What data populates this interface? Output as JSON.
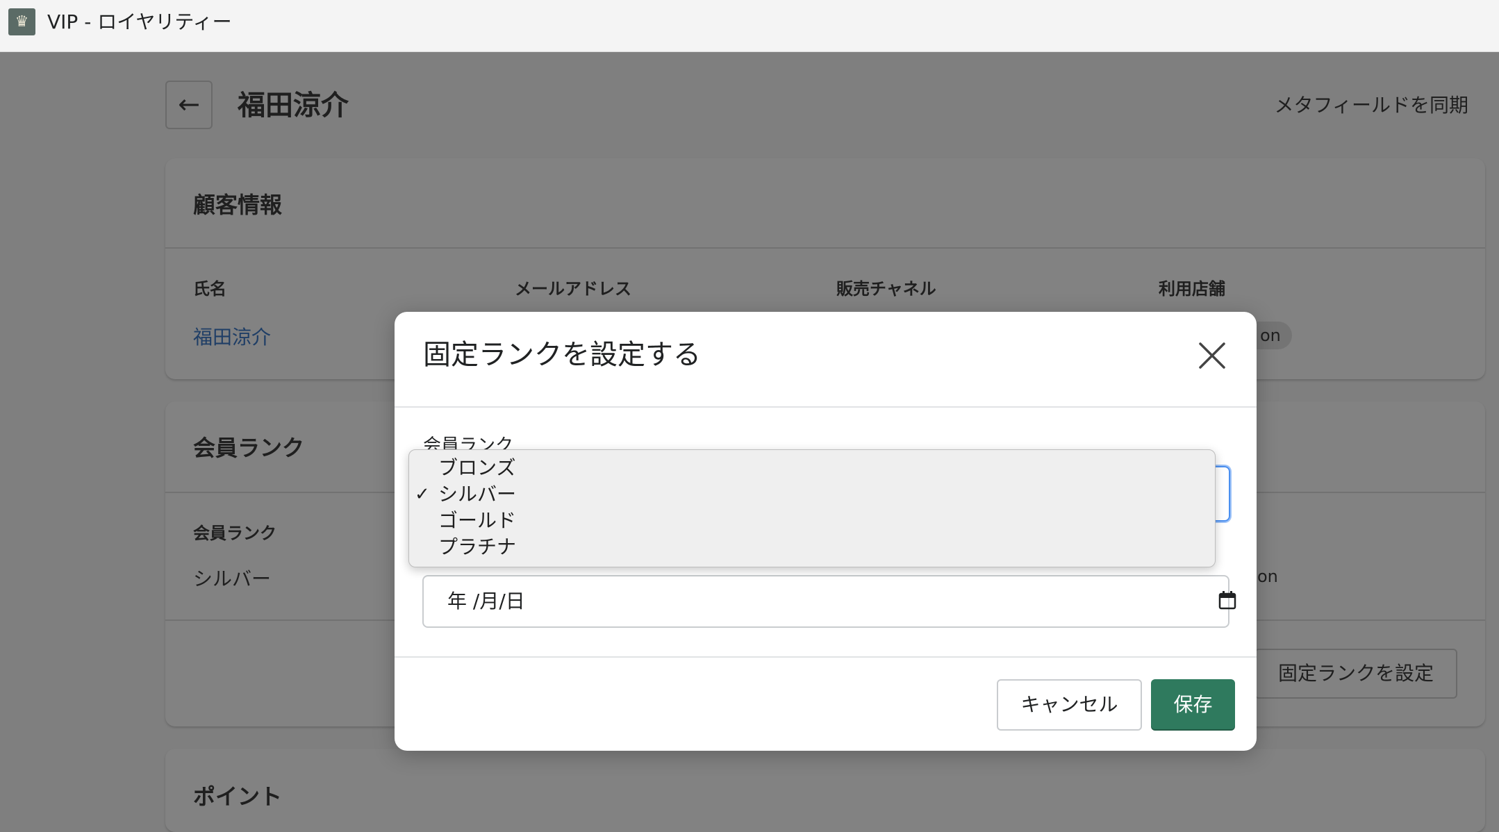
{
  "app": {
    "icon": "crown-icon",
    "title": "VIP - ロイヤリティー"
  },
  "header": {
    "back_icon": "arrow-left-icon",
    "title": "福田涼介",
    "sync_link": "メタフィールドを同期"
  },
  "customer_card": {
    "title": "顧客情報",
    "fields": [
      {
        "label": "氏名",
        "value": "福田涼介"
      },
      {
        "label": "メールアドレス"
      },
      {
        "label": "販売チャネル"
      },
      {
        "label": "利用店舗",
        "value": "on"
      }
    ]
  },
  "rank_card": {
    "title": "会員ランク",
    "label": "会員ランク",
    "value": "シルバー",
    "side_value": "on",
    "set_button": "固定ランクを設定"
  },
  "points_card": {
    "title": "ポイント"
  },
  "modal": {
    "title": "固定ランクを設定する",
    "close_icon": "close-icon",
    "rank_label": "会員ランク",
    "date_placeholder": "年 /月/日",
    "calendar_icon": "calendar-icon",
    "cancel_label": "キャンセル",
    "save_label": "保存"
  },
  "dropdown": {
    "options": [
      "ブロンズ",
      "シルバー",
      "ゴールド",
      "プラチナ"
    ],
    "selected": "シルバー",
    "check_mark": "✓"
  },
  "colors": {
    "primary": "#2f7a5e",
    "focus": "#4a8ff0",
    "link": "#2c6ecb"
  }
}
